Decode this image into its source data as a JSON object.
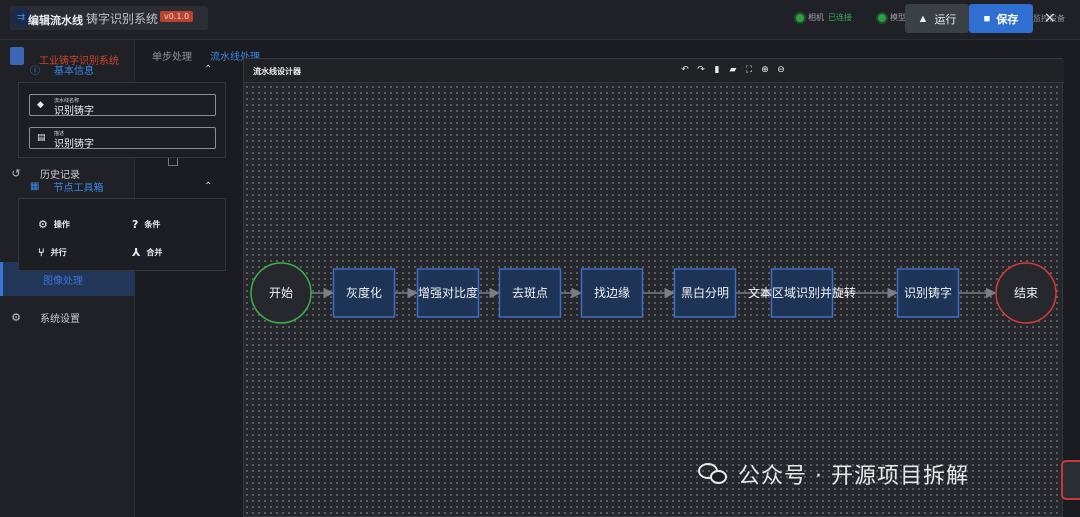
{
  "app": {
    "title": "铸字识别系统",
    "version": "v0.1.0",
    "brand_name": "工业铸字识别系统",
    "status": [
      {
        "label": "相机",
        "state": "已连接"
      },
      {
        "label": "模型",
        "state": ""
      }
    ],
    "device_text": "监控设备"
  },
  "sidebar": {
    "items": [
      {
        "label": "历史记录",
        "icon": "history-icon"
      },
      {
        "label": "图像处理",
        "icon": "image-icon"
      },
      {
        "label": "系统设置",
        "icon": "gear-icon"
      }
    ]
  },
  "tabs": [
    "单步处理",
    "流水线处理"
  ],
  "modal": {
    "title": "编辑流水线",
    "run_label": "运行",
    "save_label": "保存",
    "close_label": "×"
  },
  "basic_info": {
    "title": "基本信息",
    "name_label": "流水线名称",
    "name_value": "识别铸字",
    "desc_label": "描述",
    "desc_value": "识别铸字"
  },
  "toolbox": {
    "title": "节点工具箱",
    "tools": [
      {
        "label": "操作",
        "icon": "gear-icon"
      },
      {
        "label": "条件",
        "icon": "question-icon"
      },
      {
        "label": "并行",
        "icon": "split-icon"
      },
      {
        "label": "合并",
        "icon": "merge-icon"
      }
    ]
  },
  "designer": {
    "title": "流水线设计器",
    "toolbar": [
      "undo-icon",
      "redo-icon",
      "delete-icon",
      "folder-icon",
      "fit-icon",
      "zoom-in-icon",
      "zoom-out-icon"
    ]
  },
  "flow": {
    "start": "开始",
    "end": "结束",
    "steps": [
      "灰度化",
      "增强对比度",
      "去斑点",
      "找边缘",
      "黑白分明",
      "文本区域识别并旋转",
      "识别铸字"
    ],
    "colors": {
      "start": "#3fae4e",
      "end": "#d23b3b",
      "step_border": "#3d6fc4",
      "step_fill": "#1e3456",
      "edge": "#7a7e86"
    }
  },
  "watermark": {
    "text": "公众号 · 开源项目拆解"
  }
}
